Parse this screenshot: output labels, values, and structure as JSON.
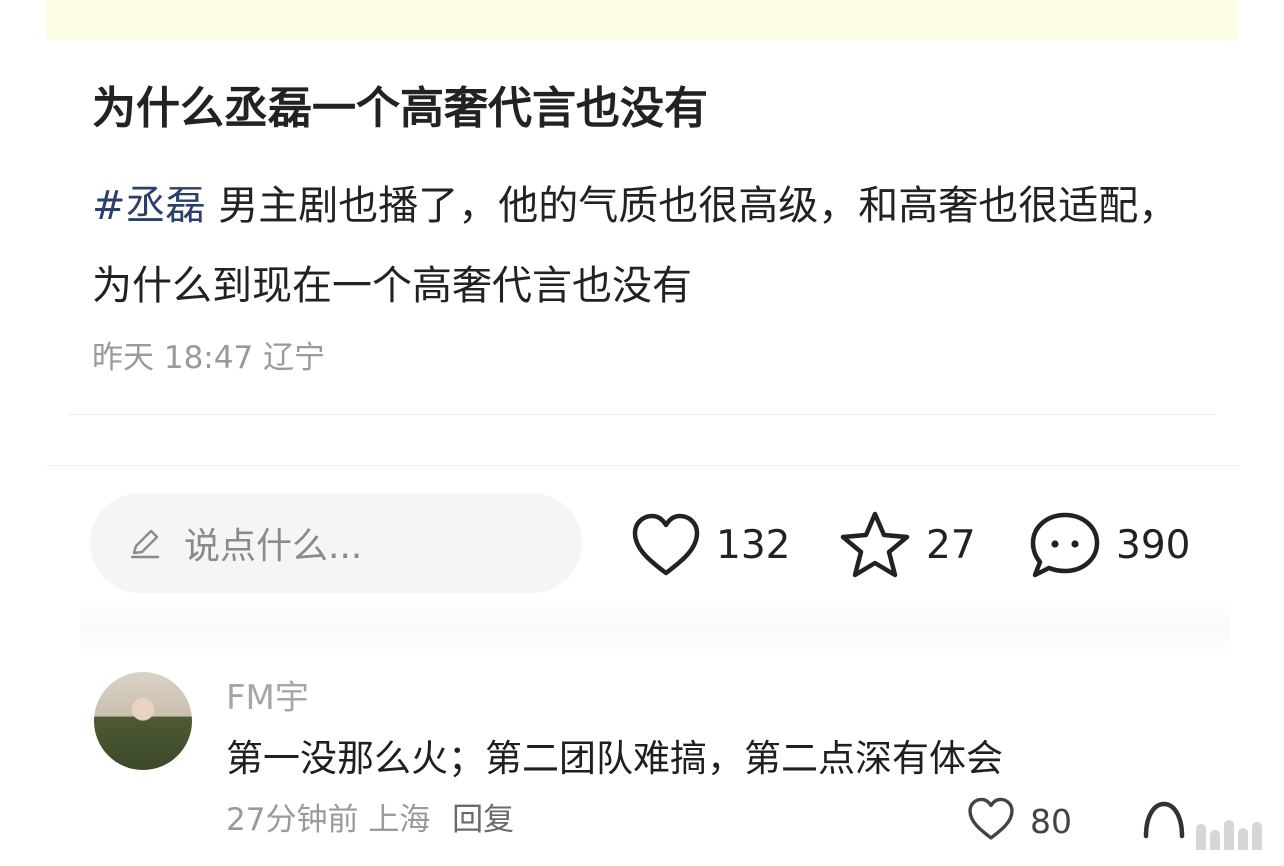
{
  "post": {
    "title": "为什么丞磊一个高奢代言也没有",
    "hashtag": "#丞磊",
    "body": " 男主剧也播了，他的气质也很高级，和高奢也很适配，为什么到现在一个高奢代言也没有",
    "time": "昨天 18:47",
    "location": "辽宁"
  },
  "action_bar": {
    "input_placeholder": "说点什么...",
    "likes": "132",
    "favorites": "27",
    "comments": "390"
  },
  "comment": {
    "user": "FM宇",
    "text": "第一没那么火；第二团队难搞，第二点深有体会",
    "time": "27分钟前",
    "location": "上海",
    "reply_label": "回复",
    "likes": "80"
  },
  "icons": {
    "pen": "pencil-icon",
    "like": "heart-icon",
    "favorite": "star-icon",
    "comment": "speech-bubble-icon"
  },
  "colors": {
    "hashtag": "#2b3f6b",
    "top_strip": "#fdfde6",
    "meta_text": "#9a9a9a"
  }
}
